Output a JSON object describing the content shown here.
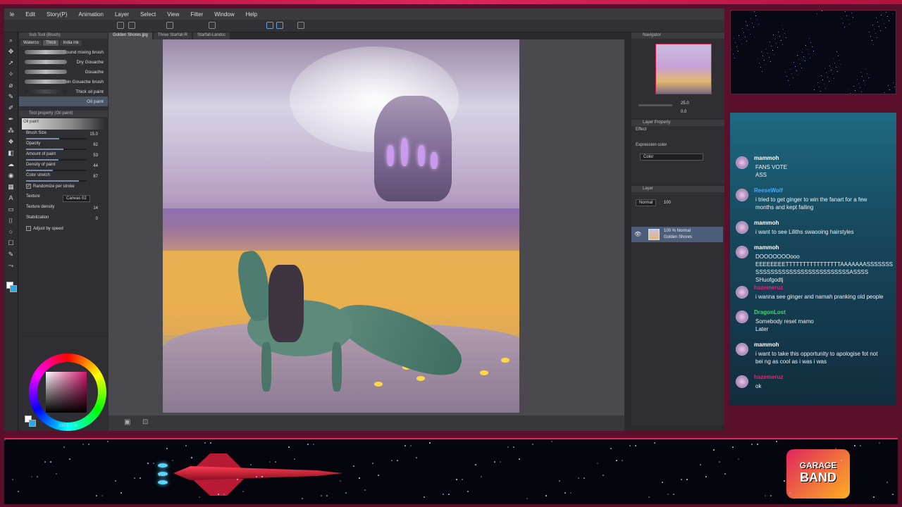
{
  "app": {
    "menu": [
      "le",
      "Edit",
      "Story(P)",
      "Animation",
      "Layer",
      "Select",
      "View",
      "Filter",
      "Window",
      "Help"
    ],
    "tabs": [
      "Golden Shores.jpg",
      "Three Starfall-R",
      "Starfall-Landsc"
    ],
    "subtool": {
      "title": "Sub Tool (Brush)",
      "tabs": [
        "Waterco",
        "Thick",
        "India ink"
      ],
      "brushes": [
        "Round mixing brush",
        "Dry Gouache",
        "Gouache",
        "Thin Gouache brush",
        "Thick oil paint",
        "Oil paint"
      ],
      "selected_brush": "Oil paint"
    },
    "tool_property": {
      "title": "Tool property (Oil paint)",
      "preset": "Oil paint",
      "rows": [
        {
          "label": "Brush Size",
          "value": "15.0",
          "fill": 0.55
        },
        {
          "label": "Opacity",
          "value": "62",
          "fill": 0.62
        },
        {
          "label": "Amount of paint",
          "value": "53",
          "fill": 0.53
        },
        {
          "label": "Density of paint",
          "value": "44",
          "fill": 0.44
        },
        {
          "label": "Color stretch",
          "value": "87",
          "fill": 0.87
        }
      ],
      "randomize": "Randomize per stroke",
      "texture_label": "Texture",
      "texture_value": "Canvas 02",
      "texture_density_label": "Texture density",
      "texture_density_value": "14",
      "stabilization_label": "Stabilization",
      "stabilization_value": "0",
      "adjust_speed": "Adjust by speed"
    },
    "color_readout": "330  0  100",
    "navigator": {
      "title": "Navigator",
      "zoom": "25.0",
      "rotation": "0.0"
    },
    "layer_property": {
      "title": "Layer Property",
      "effect": "Effect",
      "expression_color_label": "Expression color",
      "expression_color_value": "Color"
    },
    "layer": {
      "title": "Layer",
      "blend_mode": "Normal",
      "opacity": "100",
      "row_line1": "100 % Normal",
      "row_line2": "Golden Shores"
    }
  },
  "chat": {
    "messages": [
      {
        "user": "mammoh",
        "color": "#ffffff",
        "lines": [
          "FANS VOTE",
          "ASS"
        ]
      },
      {
        "user": "ReeseWolf",
        "color": "#4aa8ff",
        "lines": [
          "i tried to get ginger to win the fanart for a few",
          "months and kept failing"
        ]
      },
      {
        "user": "mammoh",
        "color": "#ffffff",
        "lines": [
          "i want to see Liliths swaooing hairstyles"
        ]
      },
      {
        "user": "mammoh",
        "color": "#ffffff",
        "lines": [
          "DOOOOOOOooo",
          "EEEEEEEETTTTTTTTTTTTTTTTAAAAAAASSSSSSS",
          "SSSSSSSSSSSSSSSSSSSSSSSSSASSSS SHuofgodtj"
        ]
      },
      {
        "user": "hazemeruz",
        "color": "#e0247a",
        "lines": [
          "i wanna see ginger and namah pranking old people"
        ]
      },
      {
        "user": "DragonLost",
        "color": "#3ddc6a",
        "lines": [
          "Somebody reset mamo",
          "Later"
        ]
      },
      {
        "user": "mammoh",
        "color": "#ffffff",
        "lines": [
          "i want to take this opportunity to apologise fot not",
          "bei ng as cool as i was i was"
        ]
      },
      {
        "user": "hazemeruz",
        "color": "#e0247a",
        "lines": [
          "ok"
        ]
      }
    ]
  },
  "badge": {
    "line1": "GARAGE",
    "line2": "BAND"
  },
  "colors": {
    "frame": "#5a0f2a",
    "accent": "#e0245e",
    "chat_bg": "#17485c"
  }
}
